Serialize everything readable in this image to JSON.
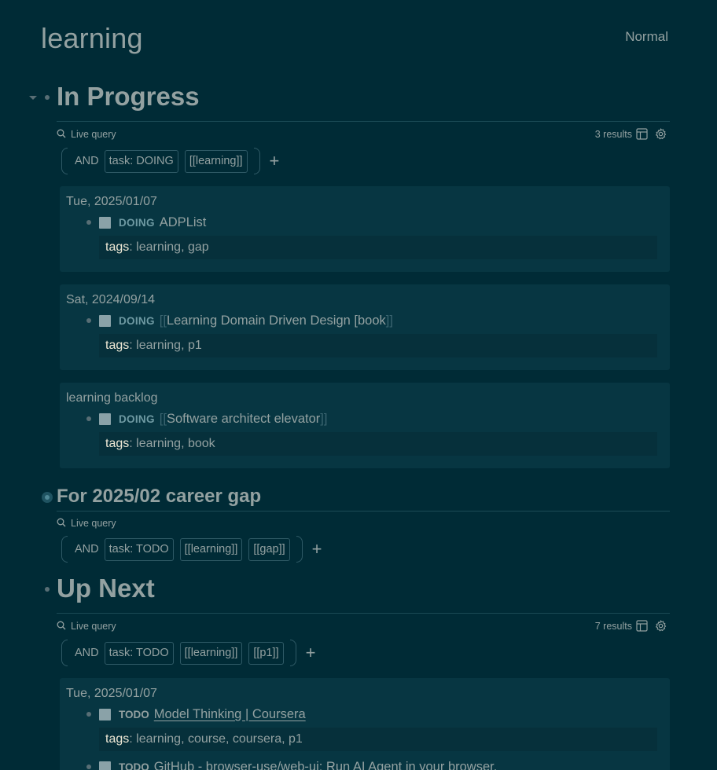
{
  "page": {
    "title": "learning",
    "mode": "Normal"
  },
  "sections": {
    "in_progress": {
      "heading": "In Progress",
      "query": {
        "label": "Live query",
        "results": "3 results",
        "op": "AND",
        "filters": [
          "task: DOING",
          "[[learning]]"
        ],
        "add": "+"
      },
      "cards": [
        {
          "group": "Tue, 2025/01/07",
          "marker": "DOING",
          "title": "ADPList",
          "props_key": "tags",
          "props_value": ": learning, gap"
        },
        {
          "group": "Sat, 2024/09/14",
          "marker": "DOING",
          "open": "[[",
          "title": "Learning Domain Driven Design [book",
          "close": "]]",
          "props_key": "tags",
          "props_value": ": learning, p1"
        },
        {
          "group": "learning backlog",
          "marker": "DOING",
          "open": "[[",
          "title": "Software architect elevator",
          "close": "]]",
          "props_key": "tags",
          "props_value": ": learning, book"
        }
      ]
    },
    "career_gap": {
      "heading": "For 2025/02 career gap",
      "query": {
        "label": "Live query",
        "op": "AND",
        "filters": [
          "task: TODO",
          "[[learning]]",
          "[[gap]]"
        ],
        "add": "+"
      }
    },
    "up_next": {
      "heading": "Up Next",
      "query": {
        "label": "Live query",
        "results": "7 results",
        "op": "AND",
        "filters": [
          "task: TODO",
          "[[learning]]",
          "[[p1]]"
        ],
        "add": "+"
      },
      "card": {
        "group": "Tue, 2025/01/07",
        "task1": {
          "marker": "TODO",
          "title": "Model Thinking | Coursera",
          "props_key": "tags",
          "props_value": ": learning, course, coursera, p1"
        },
        "task2": {
          "marker": "TODO",
          "title": "GitHub - browser-use/web-ui: Run AI Agent in your browser."
        }
      }
    }
  },
  "icons": {
    "search": "search-icon",
    "table": "table-icon",
    "settings": "gear-icon"
  },
  "colors": {
    "background": "#002b36",
    "card": "#073642",
    "text": "#93a1a1",
    "accent": "#6f9aa3"
  }
}
